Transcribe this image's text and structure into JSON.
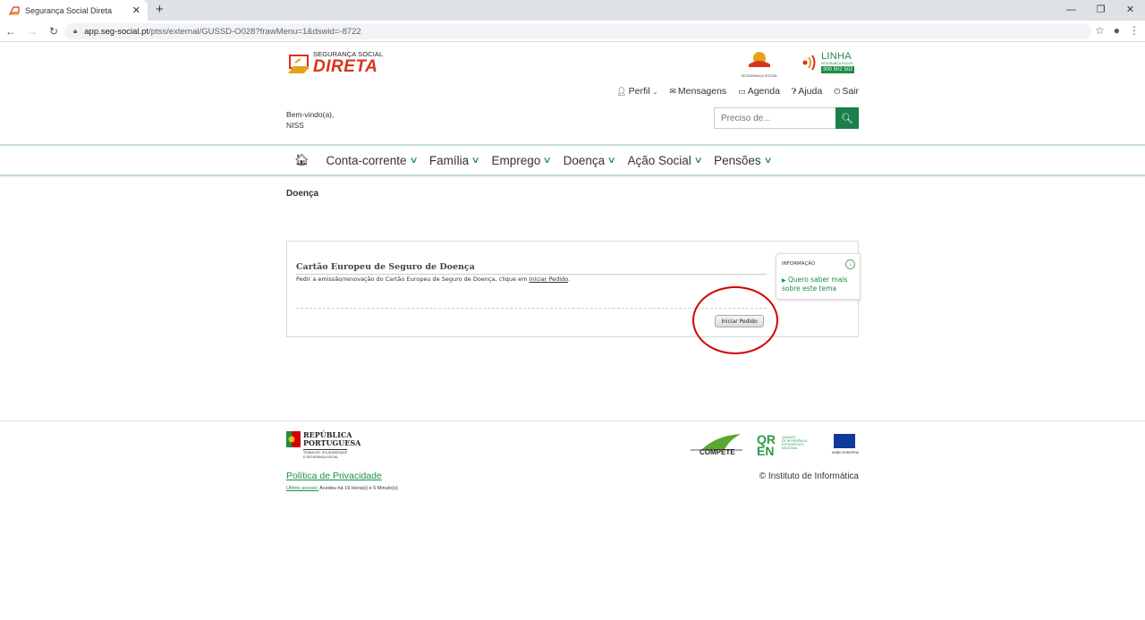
{
  "browser": {
    "tab_title": "Segurança Social Direta",
    "tab_close": "✕",
    "new_tab": "+",
    "url_host": "app.seg-social.pt",
    "url_path": "/ptss/external/GUSSD-O028?frawMenu=1&dswid=-8722",
    "window_buttons": [
      "—",
      "❐",
      "✕"
    ]
  },
  "header": {
    "logo_small": "SEGURANÇA SOCIAL",
    "logo_big": "DIRETA",
    "seg_logo_caption": "SEGURANÇA SOCIAL",
    "linha_title": "LINHA",
    "linha_sub": "SEGURANÇA SOCIAL",
    "linha_number": "300 502 502",
    "links": {
      "perfil": "Perfil",
      "mensagens": "Mensagens",
      "agenda": "Agenda",
      "ajuda": "Ajuda",
      "sair": "Sair"
    },
    "welcome_line1": "Bem-vindo(a),",
    "welcome_line2": "NISS",
    "search_placeholder": "Preciso de..."
  },
  "nav": {
    "items": [
      {
        "label": "Conta-corrente"
      },
      {
        "label": "Família"
      },
      {
        "label": "Emprego"
      },
      {
        "label": "Doença"
      },
      {
        "label": "Ação Social"
      },
      {
        "label": "Pensões"
      }
    ]
  },
  "main": {
    "page_title": "Doença",
    "panel_title": "Cartão Europeu de Seguro de Doença",
    "panel_desc": "Pedir a emissão/renovação do Cartão Europeu de Seguro de Doença, clique em",
    "panel_desc_link": "Iniciar Pedido",
    "panel_desc_end": ".",
    "button_label": "Iniciar Pedido",
    "info_title": "INFORMAÇÃO",
    "info_link": "Quero saber mais sobre este tema",
    "accent_color": "#1a8d45",
    "highlight_color": "#d40000"
  },
  "footer": {
    "rep_line1": "REPÚBLICA",
    "rep_line2": "PORTUGUESA",
    "rep_sub1": "TRABALHO, SOLIDARIEDADE",
    "rep_sub2": "E SEGURANÇA SOCIAL",
    "privacy": "Política de Privacidade",
    "last_access_label": "Último acesso:",
    "last_access_value": " Acedeu há 16 Hora(s) e 5 Minuto(s)",
    "compete": "COMPETE",
    "qren_text1": "QUADRO",
    "qren_text2": "DE REFERÊNCIA",
    "qren_text3": "ESTRATÉGICO",
    "qren_text4": "NACIONAL",
    "eu_text": "UNIÃO EUROPEIA",
    "copyright": "© Instituto de Informática"
  }
}
